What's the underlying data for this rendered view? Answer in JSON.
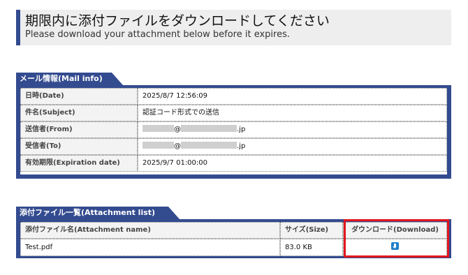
{
  "header": {
    "title": "期限内に添付ファイルをダウンロードしてください",
    "subtitle": "Please download your attachment below before it expires."
  },
  "mail_info": {
    "section_title": "メール情報(Mail info)",
    "rows": [
      {
        "label": "日時(Date)",
        "value": "2025/8/7 12:56:09"
      },
      {
        "label": "件名(Subject)",
        "value": "認証コード形式での送信"
      },
      {
        "label": "送信者(From)",
        "value": "@",
        "suffix": ".jp"
      },
      {
        "label": "受信者(To)",
        "value": "@",
        "suffix": ".jp"
      },
      {
        "label": "有効期限(Expiration date)",
        "value": "2025/9/7 01:00:00"
      }
    ]
  },
  "attachments": {
    "section_title": "添付ファイル一覧(Attachment list)",
    "headers": {
      "name": "添付ファイル名(Attachment name)",
      "size": "サイズ(Size)",
      "download": "ダウンロード(Download)"
    },
    "files": [
      {
        "name": "Test.pdf",
        "size": "83.0 KB",
        "download_icon": "download-icon"
      }
    ]
  },
  "colors": {
    "brand": "#334b8f",
    "highlight": "#e2161f",
    "download_icon": "#1f7ec8"
  }
}
